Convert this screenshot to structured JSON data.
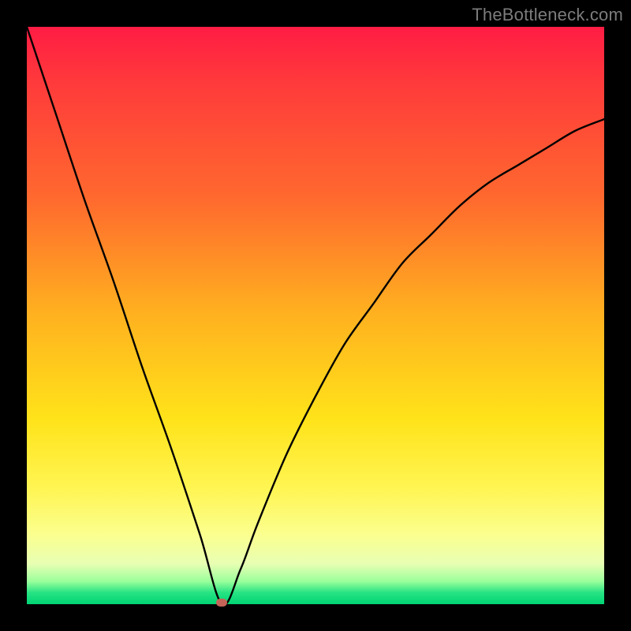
{
  "watermark": "TheBottleneck.com",
  "colors": {
    "frame": "#000000",
    "marker": "#c46458",
    "curve": "#000000"
  },
  "chart_data": {
    "type": "line",
    "title": "",
    "xlabel": "",
    "ylabel": "",
    "xlim": [
      0,
      1
    ],
    "ylim": [
      0,
      1
    ],
    "grid": false,
    "series": [
      {
        "name": "bottleneck-curve",
        "x": [
          0.0,
          0.05,
          0.1,
          0.15,
          0.2,
          0.25,
          0.3,
          0.338,
          0.37,
          0.4,
          0.45,
          0.5,
          0.55,
          0.6,
          0.65,
          0.7,
          0.75,
          0.8,
          0.85,
          0.9,
          0.95,
          1.0
        ],
        "y": [
          1.0,
          0.85,
          0.7,
          0.56,
          0.41,
          0.27,
          0.12,
          0.0,
          0.06,
          0.14,
          0.26,
          0.36,
          0.45,
          0.52,
          0.59,
          0.64,
          0.69,
          0.73,
          0.76,
          0.79,
          0.82,
          0.84
        ]
      }
    ],
    "marker": {
      "x": 0.338,
      "y": 0.003
    },
    "background_gradient": {
      "top": "#ff1c44",
      "bottom": "#00d474"
    }
  }
}
